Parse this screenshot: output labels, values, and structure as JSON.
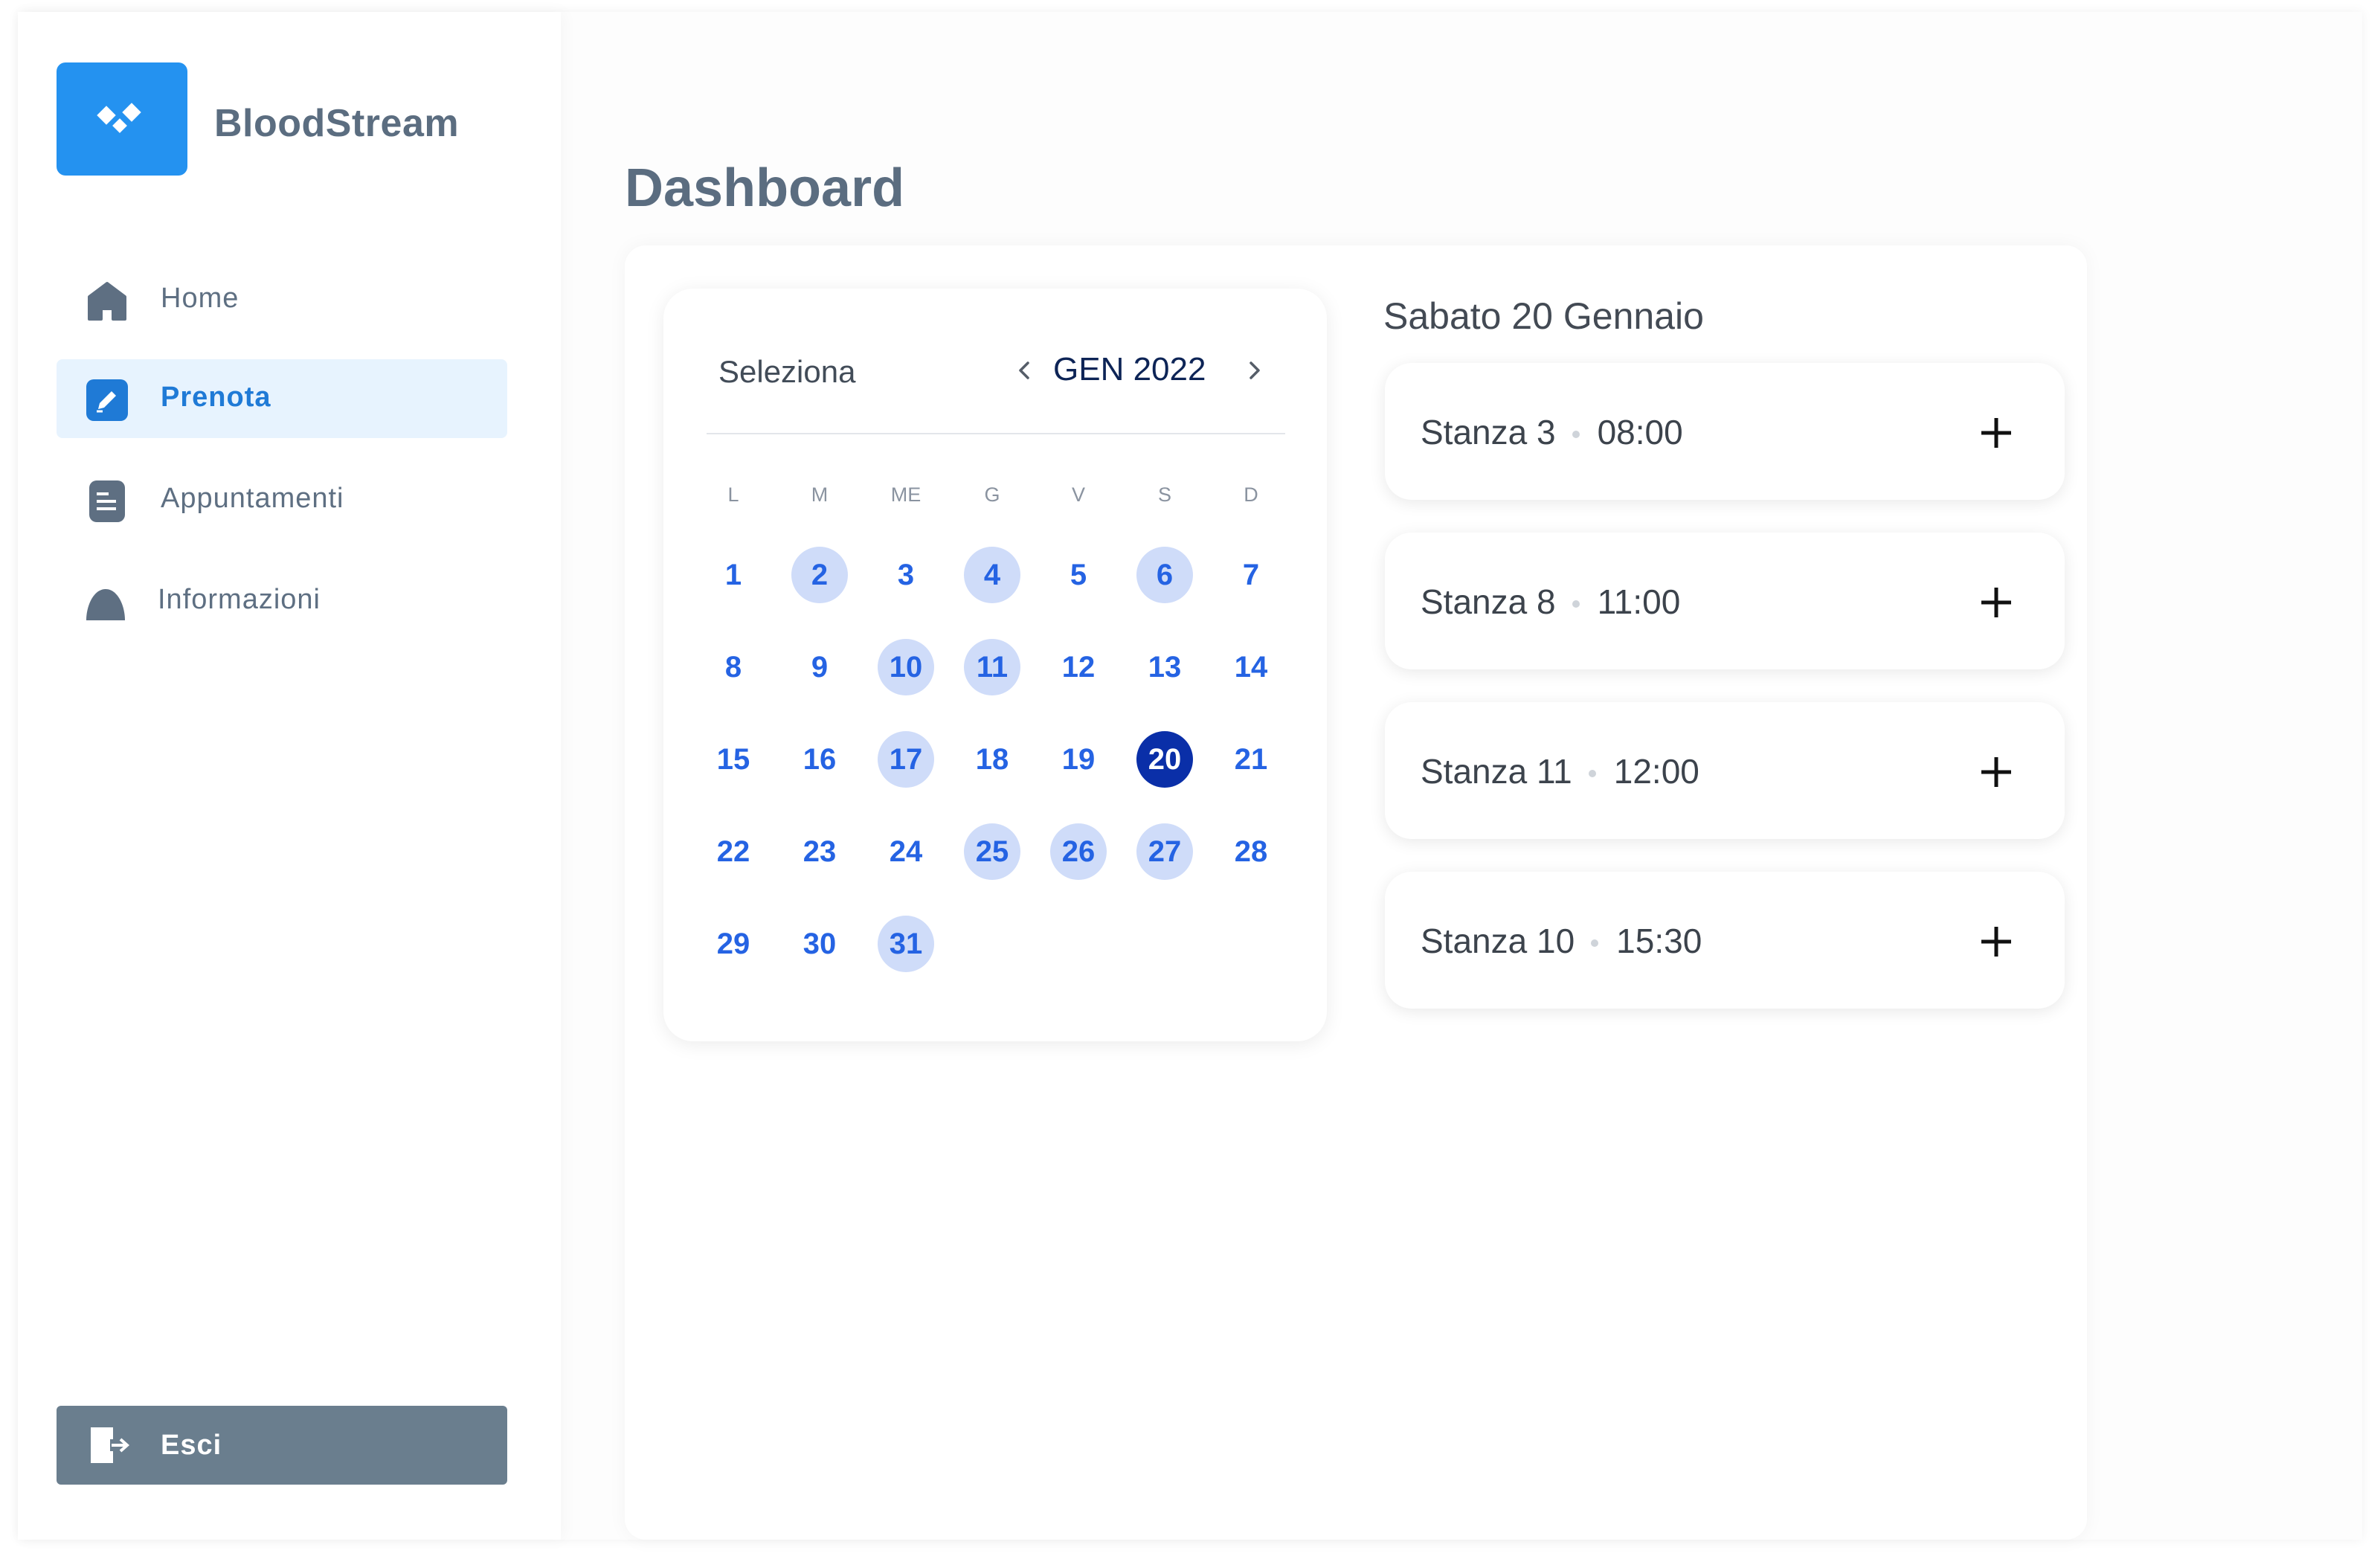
{
  "app": {
    "name": "BloodStream"
  },
  "sidebar": {
    "items": [
      {
        "label": "Home",
        "icon": "home-icon",
        "active": false
      },
      {
        "label": "Prenota",
        "icon": "edit-icon",
        "active": true
      },
      {
        "label": "Appuntamenti",
        "icon": "document-icon",
        "active": false
      },
      {
        "label": "Informazioni",
        "icon": "info-icon",
        "active": false
      }
    ],
    "logout_label": "Esci"
  },
  "page": {
    "title": "Dashboard"
  },
  "calendar": {
    "select_label": "Seleziona",
    "month_label": "GEN 2022",
    "weekdays": [
      "L",
      "M",
      "ME",
      "G",
      "V",
      "S",
      "D"
    ],
    "days": [
      "1",
      "2",
      "3",
      "4",
      "5",
      "6",
      "7",
      "8",
      "9",
      "10",
      "11",
      "12",
      "13",
      "14",
      "15",
      "16",
      "17",
      "18",
      "19",
      "20",
      "21",
      "22",
      "23",
      "24",
      "25",
      "26",
      "27",
      "28",
      "29",
      "30",
      "31"
    ],
    "available_days": [
      2,
      4,
      6,
      10,
      11,
      17,
      25,
      26,
      27,
      31
    ],
    "selected_day": 20
  },
  "slots": {
    "title": "Sabato 20 Gennaio",
    "items": [
      {
        "room": "Stanza 3",
        "time": "08:00"
      },
      {
        "room": "Stanza 8",
        "time": "11:00"
      },
      {
        "room": "Stanza 11",
        "time": "12:00"
      },
      {
        "room": "Stanza 10",
        "time": "15:30"
      }
    ]
  },
  "colors": {
    "brand": "#2492f0",
    "active_nav_bg": "#e7f3fe",
    "active_nav_text": "#1f7ad6",
    "day_text": "#2563e3",
    "available_day_bg": "#cfdcf9",
    "selected_day_bg": "#0a2fa8",
    "logout_bg": "#6a7e8e"
  }
}
